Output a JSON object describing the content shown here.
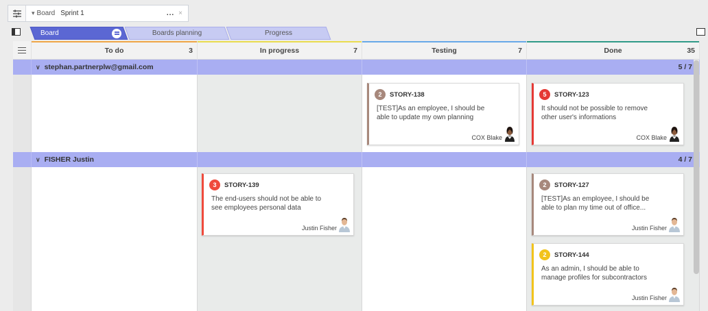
{
  "toolbar": {
    "board_label": "Board",
    "board_value": "Sprint 1",
    "more": "...",
    "clear": "×"
  },
  "tabs": [
    {
      "label": "Board",
      "active": true
    },
    {
      "label": "Boards planning",
      "active": false
    },
    {
      "label": "Progress",
      "active": false
    }
  ],
  "columns": [
    {
      "title": "To do",
      "count": "3",
      "color": "#f0a646"
    },
    {
      "title": "In progress",
      "count": "7",
      "color": "#e9dc4e"
    },
    {
      "title": "Testing",
      "count": "7",
      "color": "#67a8e8"
    },
    {
      "title": "Done",
      "count": "35",
      "color": "#2f9a88"
    }
  ],
  "lanes": [
    {
      "title": "stephan.partnerplw@gmail.com",
      "count": "5 / 7"
    },
    {
      "title": "FISHER Justin",
      "count": "4 / 7"
    }
  ],
  "cards": [
    {
      "key": "STORY-138",
      "priority": "2",
      "badge_color": "#a7887c",
      "border_color": "#a7887c",
      "desc": "[TEST]As an employee, I should be able to update my own planning",
      "assignee": "COX Blake",
      "avatar": "woman"
    },
    {
      "key": "STORY-123",
      "priority": "5",
      "badge_color": "#e53935",
      "border_color": "#e53935",
      "desc": "It should not be possible to remove other user's informations",
      "assignee": "COX Blake",
      "avatar": "woman"
    },
    {
      "key": "STORY-139",
      "priority": "3",
      "badge_color": "#ef4a3c",
      "border_color": "#ef4a3c",
      "desc": "The end-users should not be able to see employees personal data",
      "assignee": "Justin Fisher",
      "avatar": "man"
    },
    {
      "key": "STORY-127",
      "priority": "2",
      "badge_color": "#a7887c",
      "border_color": "#a7887c",
      "desc": "[TEST]As an employee, I should be able to plan my time out of office...",
      "assignee": "Justin Fisher",
      "avatar": "man"
    },
    {
      "key": "STORY-144",
      "priority": "2",
      "badge_color": "#f2c31b",
      "border_color": "#f2c31b",
      "desc": "As an admin, I should be able to manage profiles for subcontractors",
      "assignee": "Justin Fisher",
      "avatar": "man"
    }
  ]
}
